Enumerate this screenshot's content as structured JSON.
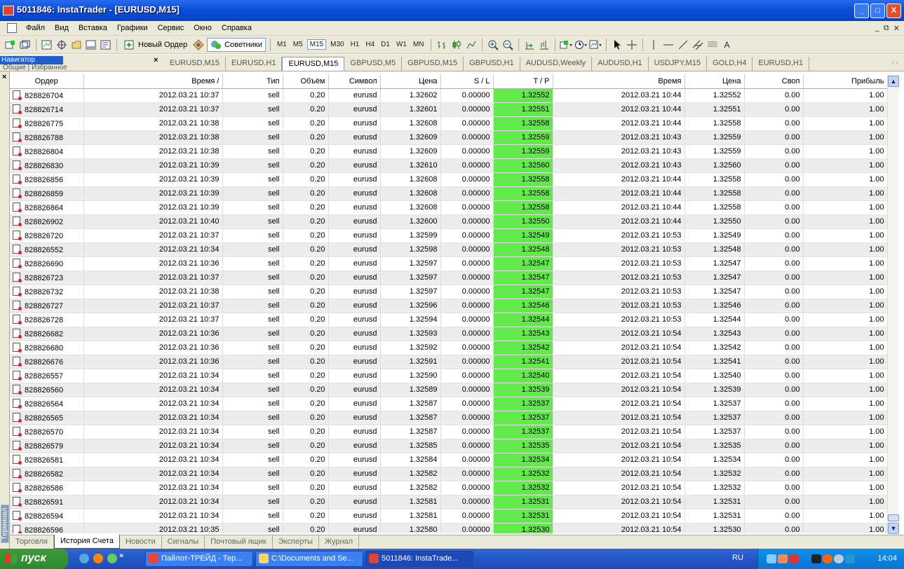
{
  "window": {
    "title": "5011846: InstaTrader - [EURUSD,M15]",
    "controls": [
      "_",
      "□",
      "X"
    ]
  },
  "menu": {
    "items": [
      "Файл",
      "Вид",
      "Вставка",
      "Графики",
      "Сервис",
      "Окно",
      "Справка"
    ],
    "mdi_controls": [
      "_",
      "⧉",
      "✕"
    ]
  },
  "toolbar": {
    "new_order_label": "Новый Ордер",
    "advisors_label": "Советники",
    "timeframes": [
      "M1",
      "M5",
      "M15",
      "M30",
      "H1",
      "H4",
      "D1",
      "W1",
      "MN"
    ],
    "active_timeframe": "M15",
    "last_label": "A"
  },
  "navigator": {
    "label": "Навигатор",
    "tabs": "Общие | Избранное",
    "close": "×"
  },
  "chart_tabs": {
    "items": [
      "EURUSD,M15",
      "EURUSD,H1",
      "EURUSD,M15",
      "GBPUSD,M5",
      "GBPUSD,M15",
      "GBPUSD,H1",
      "AUDUSD,Weekly",
      "AUDUSD,H1",
      "USDJPY,M15",
      "GOLD,H4",
      "EURUSD,H1"
    ],
    "active_index": 2,
    "scroll": "‹ ›"
  },
  "terminal": {
    "close": "×",
    "side_label": "Терминал",
    "columns": [
      "Ордер",
      "Время   /",
      "Тип",
      "Объём",
      "Символ",
      "Цена",
      "S / L",
      "T / P",
      "Время",
      "Цена",
      "Своп",
      "Прибыль"
    ],
    "rows": [
      [
        "828826704",
        "2012.03.21 10:37",
        "sell",
        "0.20",
        "eurusd",
        "1.32602",
        "0.00000",
        "1.32552",
        "2012.03.21 10:44",
        "1.32552",
        "0.00",
        "1.00"
      ],
      [
        "828826714",
        "2012.03.21 10:37",
        "sell",
        "0.20",
        "eurusd",
        "1.32601",
        "0.00000",
        "1.32551",
        "2012.03.21 10:44",
        "1.32551",
        "0.00",
        "1.00"
      ],
      [
        "828826775",
        "2012.03.21 10:38",
        "sell",
        "0.20",
        "eurusd",
        "1.32608",
        "0.00000",
        "1.32558",
        "2012.03.21 10:44",
        "1.32558",
        "0.00",
        "1.00"
      ],
      [
        "828826788",
        "2012.03.21 10:38",
        "sell",
        "0.20",
        "eurusd",
        "1.32609",
        "0.00000",
        "1.32559",
        "2012.03.21 10:43",
        "1.32559",
        "0.00",
        "1.00"
      ],
      [
        "828826804",
        "2012.03.21 10:38",
        "sell",
        "0.20",
        "eurusd",
        "1.32609",
        "0.00000",
        "1.32559",
        "2012.03.21 10:43",
        "1.32559",
        "0.00",
        "1.00"
      ],
      [
        "828826830",
        "2012.03.21 10:39",
        "sell",
        "0.20",
        "eurusd",
        "1.32610",
        "0.00000",
        "1.32560",
        "2012.03.21 10:43",
        "1.32560",
        "0.00",
        "1.00"
      ],
      [
        "828826856",
        "2012.03.21 10:39",
        "sell",
        "0.20",
        "eurusd",
        "1.32608",
        "0.00000",
        "1.32558",
        "2012.03.21 10:44",
        "1.32558",
        "0.00",
        "1.00"
      ],
      [
        "828826859",
        "2012.03.21 10:39",
        "sell",
        "0.20",
        "eurusd",
        "1.32608",
        "0.00000",
        "1.32558",
        "2012.03.21 10:44",
        "1.32558",
        "0.00",
        "1.00"
      ],
      [
        "828826864",
        "2012.03.21 10:39",
        "sell",
        "0.20",
        "eurusd",
        "1.32608",
        "0.00000",
        "1.32558",
        "2012.03.21 10:44",
        "1.32558",
        "0.00",
        "1.00"
      ],
      [
        "828826902",
        "2012.03.21 10:40",
        "sell",
        "0.20",
        "eurusd",
        "1.32600",
        "0.00000",
        "1.32550",
        "2012.03.21 10:44",
        "1.32550",
        "0.00",
        "1.00"
      ],
      [
        "828826720",
        "2012.03.21 10:37",
        "sell",
        "0.20",
        "eurusd",
        "1.32599",
        "0.00000",
        "1.32549",
        "2012.03.21 10:53",
        "1.32549",
        "0.00",
        "1.00"
      ],
      [
        "828826552",
        "2012.03.21 10:34",
        "sell",
        "0.20",
        "eurusd",
        "1.32598",
        "0.00000",
        "1.32548",
        "2012.03.21 10:53",
        "1.32548",
        "0.00",
        "1.00"
      ],
      [
        "828826690",
        "2012.03.21 10:36",
        "sell",
        "0.20",
        "eurusd",
        "1.32597",
        "0.00000",
        "1.32547",
        "2012.03.21 10:53",
        "1.32547",
        "0.00",
        "1.00"
      ],
      [
        "828826723",
        "2012.03.21 10:37",
        "sell",
        "0.20",
        "eurusd",
        "1.32597",
        "0.00000",
        "1.32547",
        "2012.03.21 10:53",
        "1.32547",
        "0.00",
        "1.00"
      ],
      [
        "828826732",
        "2012.03.21 10:38",
        "sell",
        "0.20",
        "eurusd",
        "1.32597",
        "0.00000",
        "1.32547",
        "2012.03.21 10:53",
        "1.32547",
        "0.00",
        "1.00"
      ],
      [
        "828826727",
        "2012.03.21 10:37",
        "sell",
        "0.20",
        "eurusd",
        "1.32596",
        "0.00000",
        "1.32546",
        "2012.03.21 10:53",
        "1.32546",
        "0.00",
        "1.00"
      ],
      [
        "828826728",
        "2012.03.21 10:37",
        "sell",
        "0.20",
        "eurusd",
        "1.32594",
        "0.00000",
        "1.32544",
        "2012.03.21 10:53",
        "1.32544",
        "0.00",
        "1.00"
      ],
      [
        "828826682",
        "2012.03.21 10:36",
        "sell",
        "0.20",
        "eurusd",
        "1.32593",
        "0.00000",
        "1.32543",
        "2012.03.21 10:54",
        "1.32543",
        "0.00",
        "1.00"
      ],
      [
        "828826680",
        "2012.03.21 10:36",
        "sell",
        "0.20",
        "eurusd",
        "1.32592",
        "0.00000",
        "1.32542",
        "2012.03.21 10:54",
        "1.32542",
        "0.00",
        "1.00"
      ],
      [
        "828826676",
        "2012.03.21 10:36",
        "sell",
        "0.20",
        "eurusd",
        "1.32591",
        "0.00000",
        "1.32541",
        "2012.03.21 10:54",
        "1.32541",
        "0.00",
        "1.00"
      ],
      [
        "828826557",
        "2012.03.21 10:34",
        "sell",
        "0.20",
        "eurusd",
        "1.32590",
        "0.00000",
        "1.32540",
        "2012.03.21 10:54",
        "1.32540",
        "0.00",
        "1.00"
      ],
      [
        "828826560",
        "2012.03.21 10:34",
        "sell",
        "0.20",
        "eurusd",
        "1.32589",
        "0.00000",
        "1.32539",
        "2012.03.21 10:54",
        "1.32539",
        "0.00",
        "1.00"
      ],
      [
        "828826564",
        "2012.03.21 10:34",
        "sell",
        "0.20",
        "eurusd",
        "1.32587",
        "0.00000",
        "1.32537",
        "2012.03.21 10:54",
        "1.32537",
        "0.00",
        "1.00"
      ],
      [
        "828826565",
        "2012.03.21 10:34",
        "sell",
        "0.20",
        "eurusd",
        "1.32587",
        "0.00000",
        "1.32537",
        "2012.03.21 10:54",
        "1.32537",
        "0.00",
        "1.00"
      ],
      [
        "828826570",
        "2012.03.21 10:34",
        "sell",
        "0.20",
        "eurusd",
        "1.32587",
        "0.00000",
        "1.32537",
        "2012.03.21 10:54",
        "1.32537",
        "0.00",
        "1.00"
      ],
      [
        "828826579",
        "2012.03.21 10:34",
        "sell",
        "0.20",
        "eurusd",
        "1.32585",
        "0.00000",
        "1.32535",
        "2012.03.21 10:54",
        "1.32535",
        "0.00",
        "1.00"
      ],
      [
        "828826581",
        "2012.03.21 10:34",
        "sell",
        "0.20",
        "eurusd",
        "1.32584",
        "0.00000",
        "1.32534",
        "2012.03.21 10:54",
        "1.32534",
        "0.00",
        "1.00"
      ],
      [
        "828826582",
        "2012.03.21 10:34",
        "sell",
        "0.20",
        "eurusd",
        "1.32582",
        "0.00000",
        "1.32532",
        "2012.03.21 10:54",
        "1.32532",
        "0.00",
        "1.00"
      ],
      [
        "828826586",
        "2012.03.21 10:34",
        "sell",
        "0.20",
        "eurusd",
        "1.32582",
        "0.00000",
        "1.32532",
        "2012.03.21 10:54",
        "1.32532",
        "0.00",
        "1.00"
      ],
      [
        "828826591",
        "2012.03.21 10:34",
        "sell",
        "0.20",
        "eurusd",
        "1.32581",
        "0.00000",
        "1.32531",
        "2012.03.21 10:54",
        "1.32531",
        "0.00",
        "1.00"
      ],
      [
        "828826594",
        "2012.03.21 10:34",
        "sell",
        "0.20",
        "eurusd",
        "1.32581",
        "0.00000",
        "1.32531",
        "2012.03.21 10:54",
        "1.32531",
        "0.00",
        "1.00"
      ],
      [
        "828826596",
        "2012.03.21 10:35",
        "sell",
        "0.20",
        "eurusd",
        "1.32580",
        "0.00000",
        "1.32530",
        "2012.03.21 10:54",
        "1.32530",
        "0.00",
        "1.00"
      ]
    ],
    "tabs": [
      "Торговля",
      "История Счета",
      "Новости",
      "Сигналы",
      "Почтовый ящик",
      "Эксперты",
      "Журнал"
    ],
    "active_tab_index": 1,
    "tp_highlight_color": "#62ea4a"
  },
  "taskbar": {
    "start_label": "пуск",
    "quicklaunch_more": "»",
    "tasks": [
      "Пайлот-ТРЕЙД - Тер...",
      "C:\\Documents and Se...",
      "5011846: InstaTrade..."
    ],
    "active_task_index": 2,
    "language": "RU",
    "clock": "14:04"
  }
}
